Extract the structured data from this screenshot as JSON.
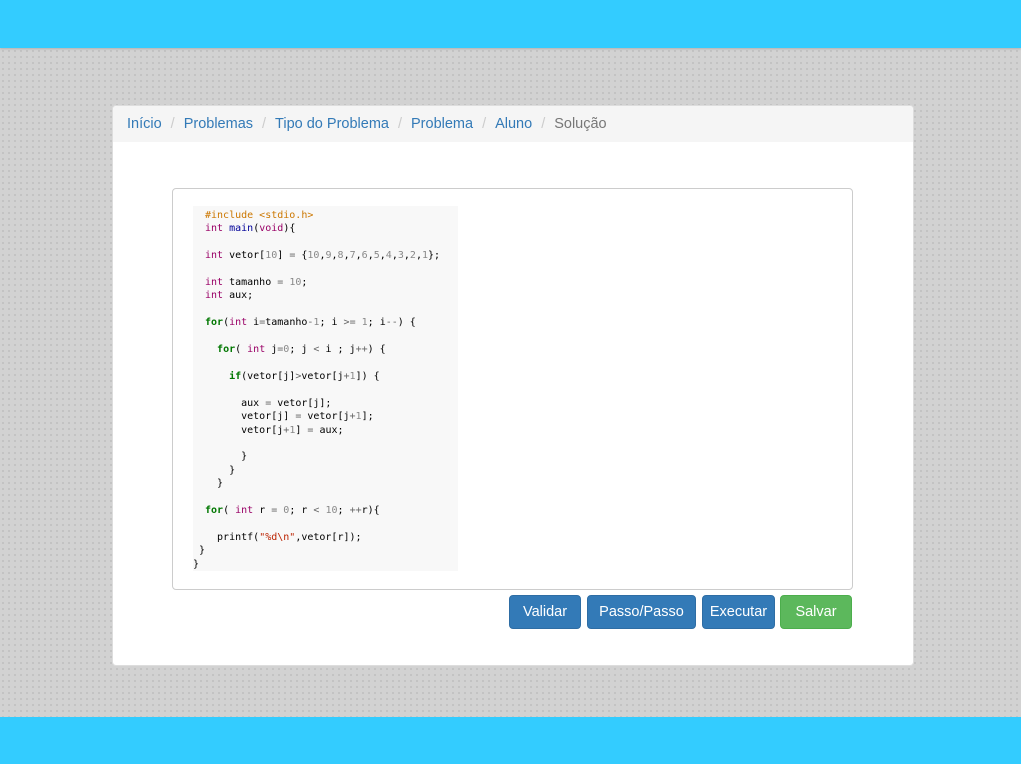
{
  "breadcrumb": {
    "items": [
      "Início",
      "Problemas",
      "Tipo do Problema",
      "Problema",
      "Aluno"
    ],
    "active": "Solução",
    "separator": "/"
  },
  "code": {
    "lines": [
      [
        [
          "pre",
          "#include <stdio.h>"
        ]
      ],
      [
        [
          "kw-type",
          "int"
        ],
        [
          "",
          " "
        ],
        [
          "kw-fn",
          "main"
        ],
        [
          "",
          "("
        ],
        [
          "kw-type",
          "void"
        ],
        [
          "",
          "){"
        ]
      ],
      [],
      [
        [
          "kw-type",
          "int"
        ],
        [
          "",
          " vetor["
        ],
        [
          "num",
          "10"
        ],
        [
          "",
          "] "
        ],
        [
          "op",
          "="
        ],
        [
          "",
          " {"
        ],
        [
          "num",
          "10"
        ],
        [
          "",
          ","
        ],
        [
          "num",
          "9"
        ],
        [
          "",
          ","
        ],
        [
          "num",
          "8"
        ],
        [
          "",
          ","
        ],
        [
          "num",
          "7"
        ],
        [
          "",
          ","
        ],
        [
          "num",
          "6"
        ],
        [
          "",
          ","
        ],
        [
          "num",
          "5"
        ],
        [
          "",
          ","
        ],
        [
          "num",
          "4"
        ],
        [
          "",
          ","
        ],
        [
          "num",
          "3"
        ],
        [
          "",
          ","
        ],
        [
          "num",
          "2"
        ],
        [
          "",
          ","
        ],
        [
          "num",
          "1"
        ],
        [
          "",
          "};"
        ]
      ],
      [],
      [
        [
          "kw-type",
          "int"
        ],
        [
          "",
          " tamanho "
        ],
        [
          "op",
          "="
        ],
        [
          "",
          " "
        ],
        [
          "num",
          "10"
        ],
        [
          "",
          ";"
        ]
      ],
      [
        [
          "kw-type",
          "int"
        ],
        [
          "",
          " aux;"
        ]
      ],
      [],
      [
        [
          "kw-ctrl",
          "for"
        ],
        [
          "",
          "("
        ],
        [
          "kw-type",
          "int"
        ],
        [
          "",
          " i"
        ],
        [
          "op",
          "="
        ],
        [
          "",
          "tamanho"
        ],
        [
          "op",
          "-"
        ],
        [
          "num",
          "1"
        ],
        [
          "",
          "; i "
        ],
        [
          "op",
          ">="
        ],
        [
          "",
          " "
        ],
        [
          "num",
          "1"
        ],
        [
          "",
          "; i"
        ],
        [
          "op",
          "--"
        ],
        [
          "",
          ") {"
        ]
      ],
      [],
      [
        [
          "",
          "  "
        ],
        [
          "kw-ctrl",
          "for"
        ],
        [
          "",
          "( "
        ],
        [
          "kw-type",
          "int"
        ],
        [
          "",
          " j"
        ],
        [
          "op",
          "="
        ],
        [
          "num",
          "0"
        ],
        [
          "",
          "; j "
        ],
        [
          "op",
          "<"
        ],
        [
          "",
          " i ; j"
        ],
        [
          "op",
          "++"
        ],
        [
          "",
          ") {"
        ]
      ],
      [],
      [
        [
          "",
          "    "
        ],
        [
          "kw-ctrl",
          "if"
        ],
        [
          "",
          "(vetor[j]"
        ],
        [
          "op",
          ">"
        ],
        [
          "",
          "vetor[j"
        ],
        [
          "op",
          "+"
        ],
        [
          "num",
          "1"
        ],
        [
          "",
          "]) {"
        ]
      ],
      [],
      [
        [
          "",
          "      aux "
        ],
        [
          "op",
          "="
        ],
        [
          "",
          " vetor[j];"
        ]
      ],
      [
        [
          "",
          "      vetor[j] "
        ],
        [
          "op",
          "="
        ],
        [
          "",
          " vetor[j"
        ],
        [
          "op",
          "+"
        ],
        [
          "num",
          "1"
        ],
        [
          "",
          "];"
        ]
      ],
      [
        [
          "",
          "      vetor[j"
        ],
        [
          "op",
          "+"
        ],
        [
          "num",
          "1"
        ],
        [
          "",
          "] "
        ],
        [
          "op",
          "="
        ],
        [
          "",
          " aux;"
        ]
      ],
      [],
      [
        [
          "",
          "      }"
        ]
      ],
      [
        [
          "",
          "    }"
        ]
      ],
      [
        [
          "",
          "  }"
        ]
      ],
      [],
      [
        [
          "kw-ctrl",
          "for"
        ],
        [
          "",
          "( "
        ],
        [
          "kw-type",
          "int"
        ],
        [
          "",
          " r "
        ],
        [
          "op",
          "="
        ],
        [
          "",
          " "
        ],
        [
          "num",
          "0"
        ],
        [
          "",
          "; r "
        ],
        [
          "op",
          "<"
        ],
        [
          "",
          " "
        ],
        [
          "num",
          "10"
        ],
        [
          "",
          "; "
        ],
        [
          "op",
          "++"
        ],
        [
          "",
          "r){"
        ]
      ],
      [],
      [
        [
          "",
          "  printf("
        ],
        [
          "str",
          "\"%d\\n\""
        ],
        [
          "",
          ",vetor[r]);"
        ]
      ],
      [
        [
          "",
          "}"
        ]
      ],
      [
        [
          "",
          "}"
        ]
      ]
    ],
    "indents": [
      2,
      2,
      0,
      2,
      0,
      2,
      2,
      0,
      2,
      0,
      2,
      0,
      2,
      0,
      2,
      2,
      2,
      0,
      2,
      2,
      2,
      0,
      2,
      0,
      2,
      1,
      0
    ]
  },
  "buttons": {
    "validar": "Validar",
    "passo": "Passo/Passo",
    "executar": "Executar",
    "salvar": "Salvar"
  },
  "colors": {
    "header": "#33ccff",
    "primary": "#337ab7",
    "success": "#5cb85c"
  }
}
